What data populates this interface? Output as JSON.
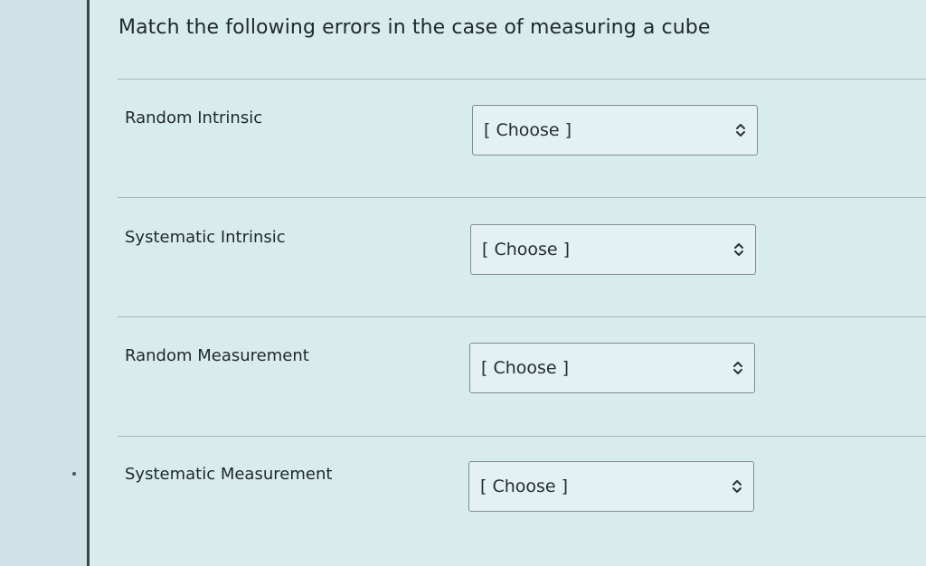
{
  "question": {
    "title": "Match the following errors in the case of measuring a cube"
  },
  "rows": [
    {
      "label": "Random Intrinsic",
      "select_value": "[ Choose ]"
    },
    {
      "label": "Systematic Intrinsic",
      "select_value": "[ Choose ]"
    },
    {
      "label": "Random Measurement",
      "select_value": "[ Choose ]"
    },
    {
      "label": "Systematic Measurement",
      "select_value": "[ Choose ]"
    }
  ],
  "icons": {
    "select_arrow": "up-down-chevron-icon"
  },
  "colors": {
    "background": "#d4e7ea",
    "panel": "#d8ecee",
    "border": "#3d4548",
    "text": "#1f2a2e"
  }
}
